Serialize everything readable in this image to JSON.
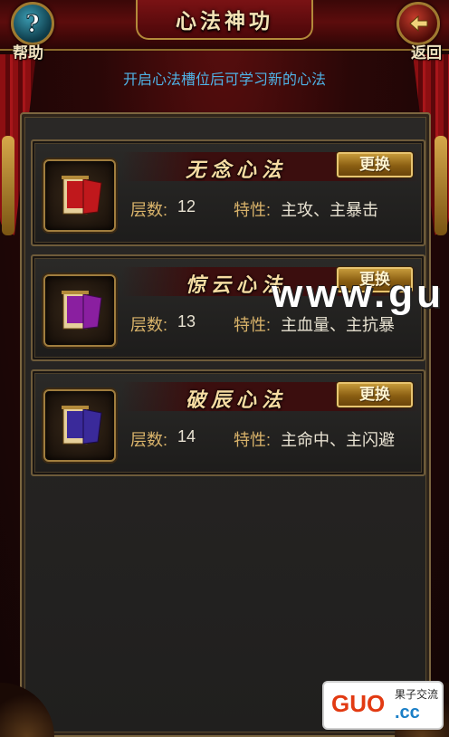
{
  "header": {
    "title": "心法神功",
    "help_label": "帮助",
    "back_label": "返回"
  },
  "subtitle": "开启心法槽位后可学习新的心法",
  "cards": [
    {
      "name": "无念心法",
      "level_label": "层数:",
      "level": "12",
      "trait_label": "特性:",
      "trait": "主攻、主暴击",
      "change_label": "更换",
      "scroll_color": "#c0181c"
    },
    {
      "name": "惊云心法",
      "level_label": "层数:",
      "level": "13",
      "trait_label": "特性:",
      "trait": "主血量、主抗暴",
      "change_label": "更换",
      "scroll_color": "#8a1fa0"
    },
    {
      "name": "破辰心法",
      "level_label": "层数:",
      "level": "14",
      "trait_label": "特性:",
      "trait": "主命中、主闪避",
      "change_label": "更换",
      "scroll_color": "#3a2a9a"
    }
  ],
  "watermark": "www.gu",
  "logo": {
    "main": "GUO",
    "top": "果子交流",
    "suffix": ".cc"
  },
  "colors": {
    "title_text": "#f3e3b6",
    "subtitle": "#4fb3e6",
    "stat_label": "#d9b36a",
    "card_name": "#f6dca2"
  }
}
